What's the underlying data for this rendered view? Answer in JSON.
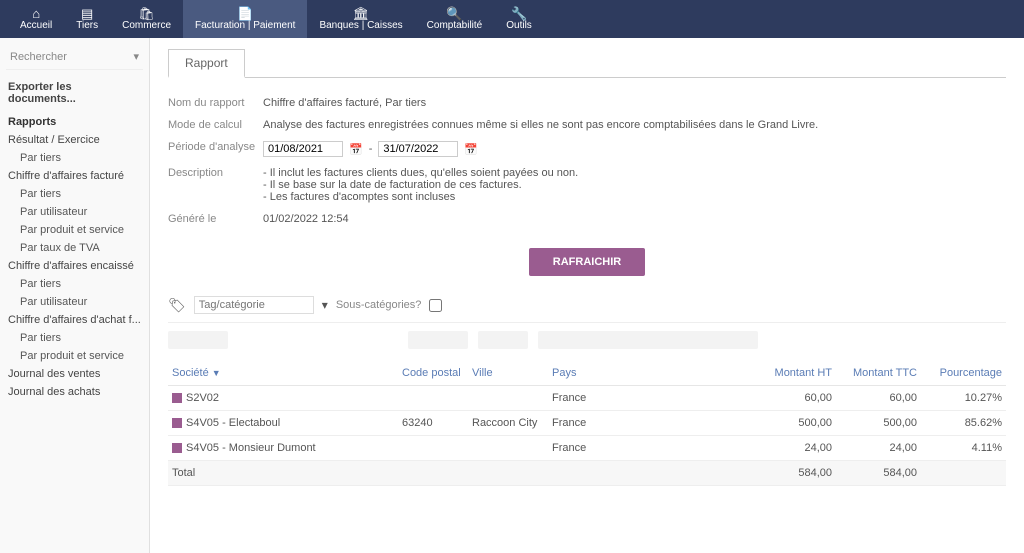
{
  "topnav": [
    {
      "icon": "⌂",
      "label": "Accueil",
      "name": "nav-accueil"
    },
    {
      "icon": "▤",
      "label": "Tiers",
      "name": "nav-tiers"
    },
    {
      "icon": "🛍",
      "label": "Commerce",
      "name": "nav-commerce"
    },
    {
      "icon": "📄",
      "label": "Facturation | Paiement",
      "name": "nav-facturation",
      "active": true
    },
    {
      "icon": "🏛",
      "label": "Banques | Caisses",
      "name": "nav-banques"
    },
    {
      "icon": "🔍",
      "label": "Comptabilité",
      "name": "nav-comptabilite"
    },
    {
      "icon": "🔧",
      "label": "Outils",
      "name": "nav-outils"
    }
  ],
  "sidebar": {
    "search": "Rechercher",
    "export": "Exporter les documents...",
    "heading": "Rapports",
    "groups": [
      {
        "title": "Résultat / Exercice",
        "items": [
          "Par tiers"
        ]
      },
      {
        "title": "Chiffre d'affaires facturé",
        "items": [
          "Par tiers",
          "Par utilisateur",
          "Par produit et service",
          "Par taux de TVA"
        ]
      },
      {
        "title": "Chiffre d'affaires encaissé",
        "items": [
          "Par tiers",
          "Par utilisateur"
        ]
      },
      {
        "title": "Chiffre d'affaires d'achat f...",
        "items": [
          "Par tiers",
          "Par produit et service"
        ]
      }
    ],
    "extras": [
      "Journal des ventes",
      "Journal des achats"
    ]
  },
  "report": {
    "tab": "Rapport",
    "fields": {
      "name_label": "Nom du rapport",
      "name_value": "Chiffre d'affaires facturé, Par tiers",
      "mode_label": "Mode de calcul",
      "mode_value": "Analyse des factures enregistrées connues même si elles ne sont pas encore comptabilisées dans le Grand Livre.",
      "period_label": "Période d'analyse",
      "period_from": "01/08/2021",
      "period_to": "31/07/2022",
      "period_sep": "-",
      "desc_label": "Description",
      "desc_lines": [
        "- Il inclut les factures clients dues, qu'elles soient payées ou non.",
        "- Il se base sur la date de facturation de ces factures.",
        "- Les factures d'acomptes sont incluses"
      ],
      "gen_label": "Généré le",
      "gen_value": "01/02/2022 12:54"
    },
    "refresh": "RAFRAICHIR",
    "tag_placeholder": "Tag/catégorie",
    "subcat_label": "Sous-catégories?"
  },
  "table": {
    "headers": {
      "societe": "Société",
      "code": "Code postal",
      "ville": "Ville",
      "pays": "Pays",
      "montant_ht": "Montant HT",
      "montant_ttc": "Montant TTC",
      "pct": "Pourcentage"
    },
    "sort_indicator": "▼",
    "rows": [
      {
        "societe": "S2V02",
        "code": "",
        "ville": "",
        "pays": "France",
        "ht": "60,00",
        "ttc": "60,00",
        "pct": "10.27%"
      },
      {
        "societe": "S4V05 - Electaboul",
        "code": "63240",
        "ville": "Raccoon City",
        "pays": "France",
        "ht": "500,00",
        "ttc": "500,00",
        "pct": "85.62%"
      },
      {
        "societe": "S4V05 - Monsieur Dumont",
        "code": "",
        "ville": "",
        "pays": "France",
        "ht": "24,00",
        "ttc": "24,00",
        "pct": "4.11%"
      }
    ],
    "total": {
      "label": "Total",
      "ht": "584,00",
      "ttc": "584,00"
    }
  }
}
